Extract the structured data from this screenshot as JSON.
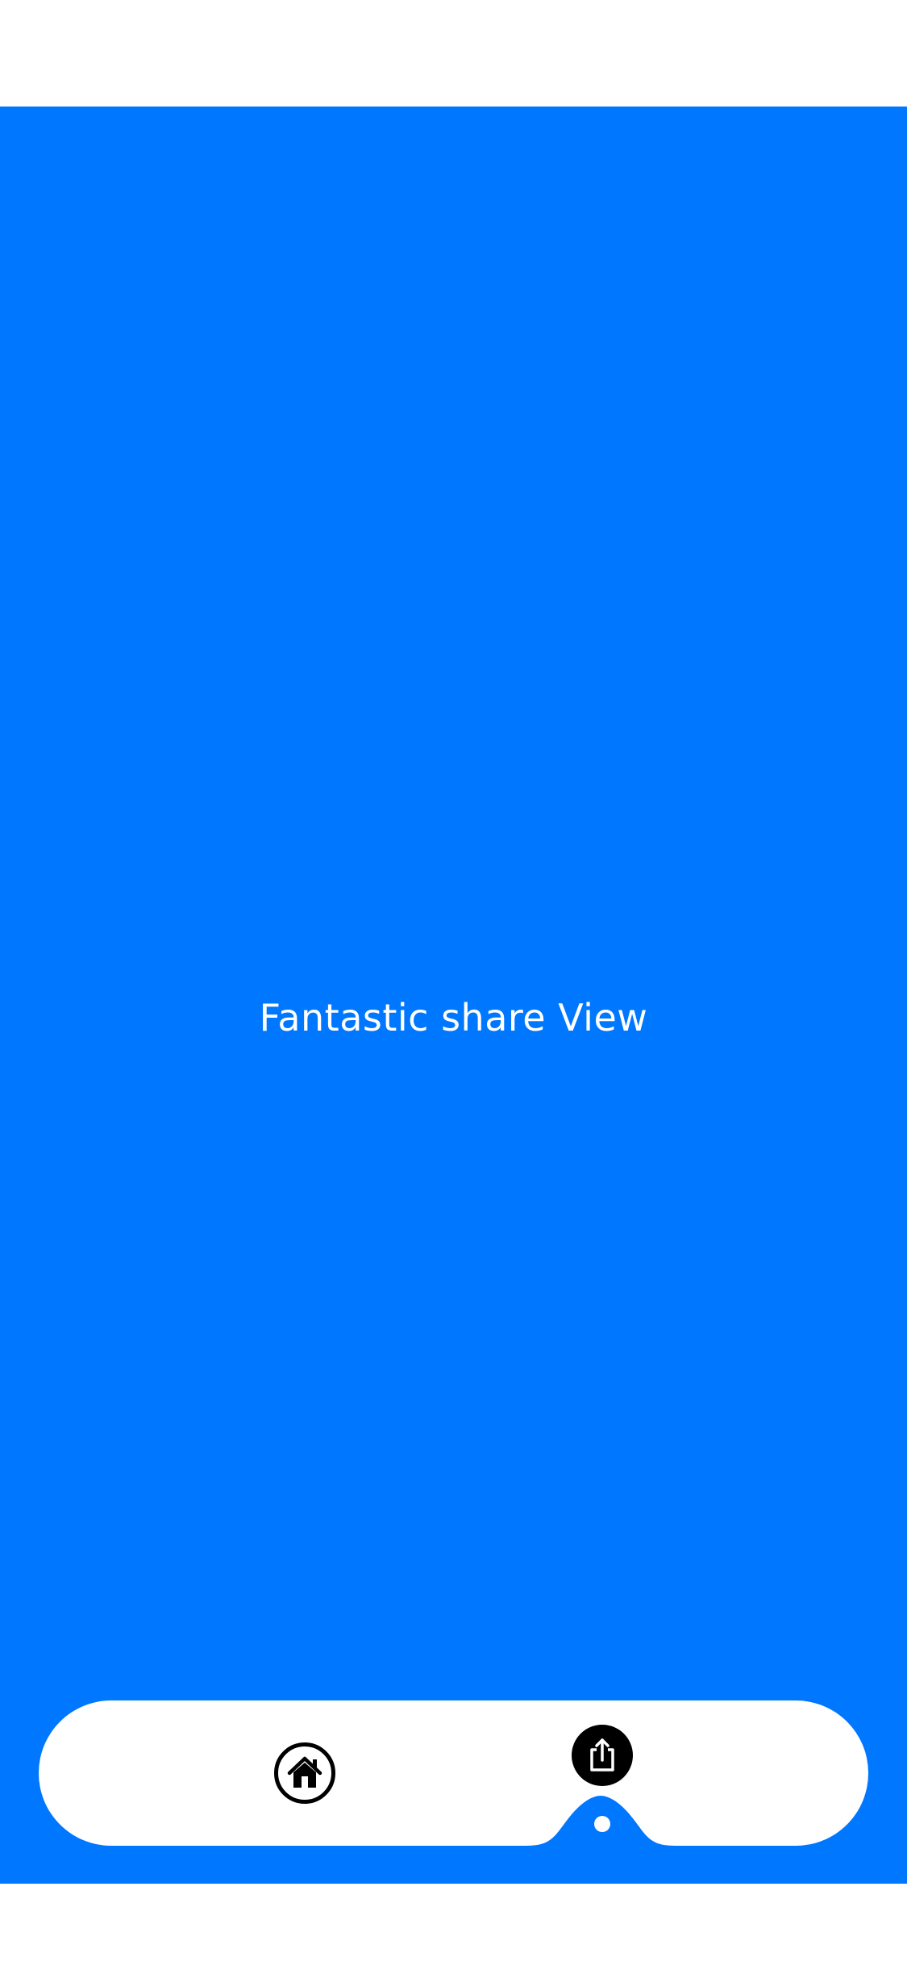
{
  "screen": {
    "background_color": "#0077FF",
    "title": "Fantastic share View"
  },
  "tabbar": {
    "items": [
      {
        "id": "home",
        "icon": "home-icon",
        "selected": false
      },
      {
        "id": "share",
        "icon": "share-icon",
        "selected": true
      }
    ],
    "indicator_color": "#FFFFFF"
  }
}
